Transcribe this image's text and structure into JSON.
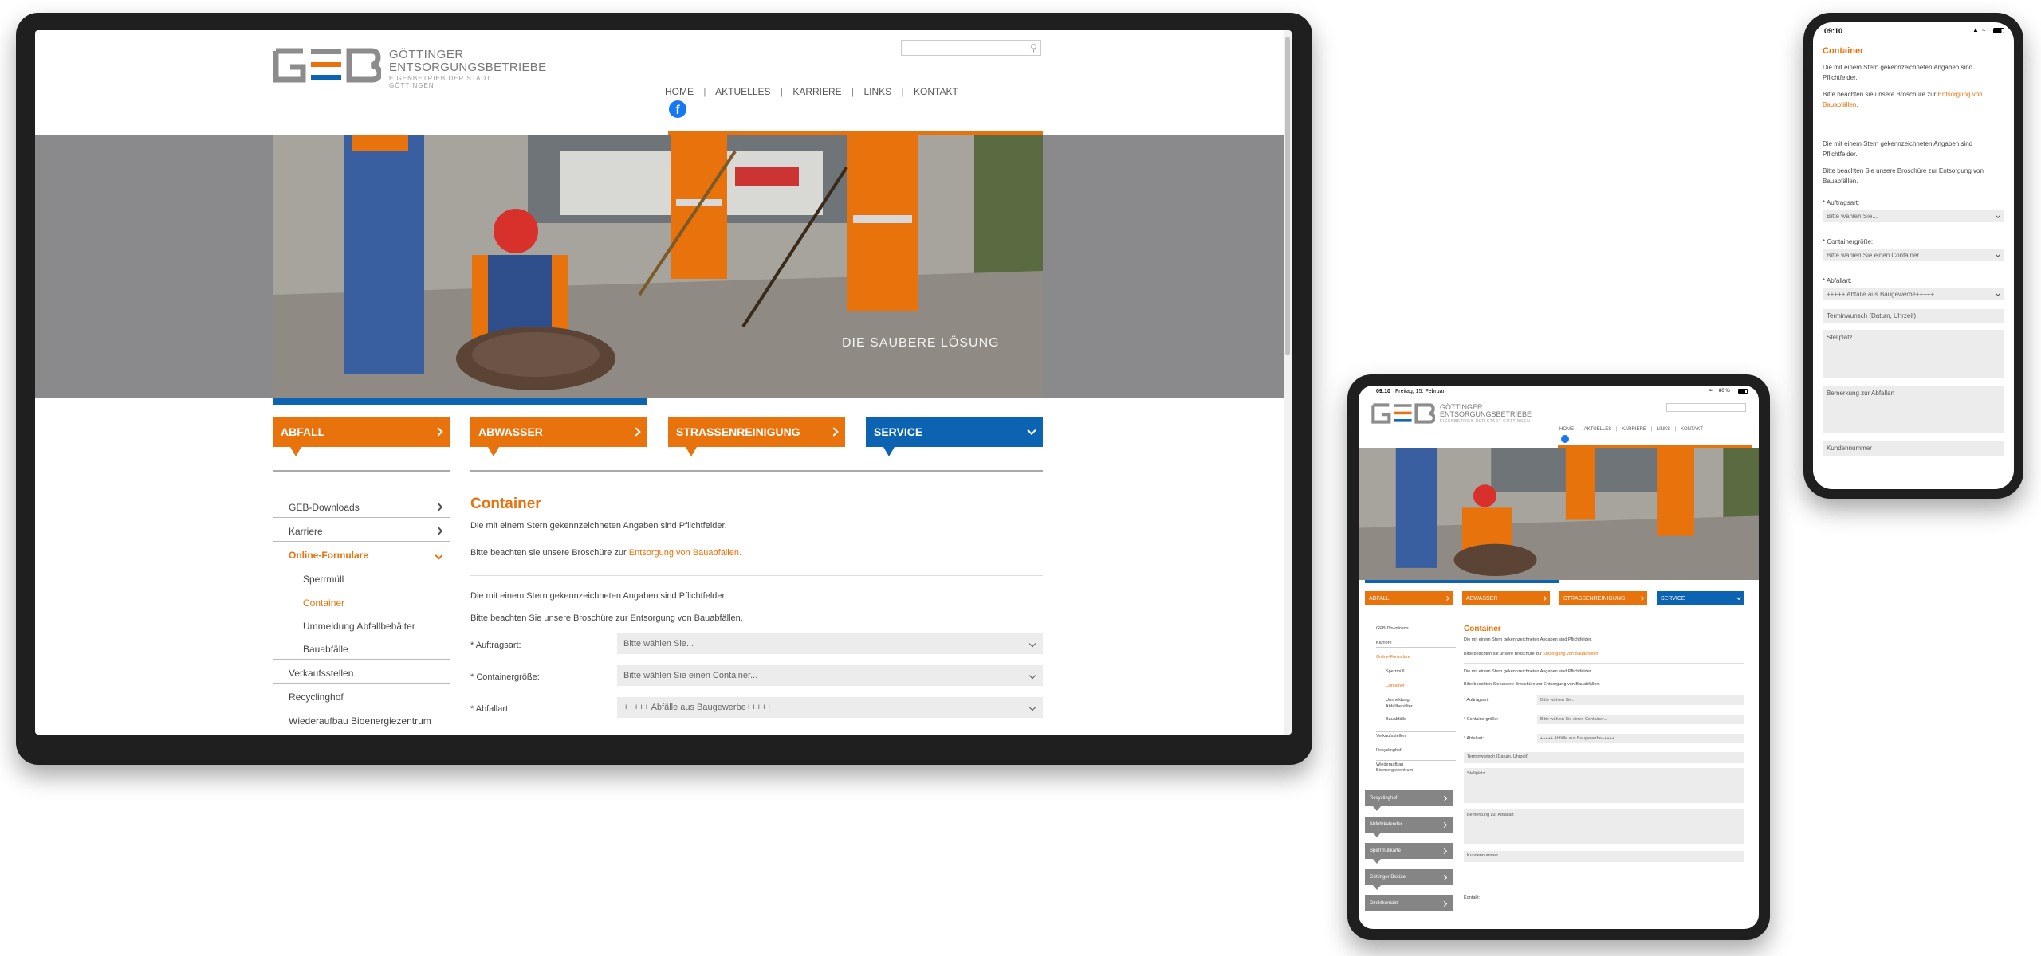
{
  "brand": {
    "logo_text": "GEB",
    "name_line1": "GÖTTINGER",
    "name_line2": "ENTSORGUNGSBETRIEBE",
    "tagline": "EIGENBETRIEB DER STADT GÖTTINGEN"
  },
  "colors": {
    "orange": "#e8720c",
    "blue": "#0b63b1",
    "grey": "#858585"
  },
  "icons": {
    "search": "search-icon",
    "facebook": "facebook-icon",
    "chevron": "chevron-right-icon"
  },
  "nav": {
    "items": [
      "HOME",
      "AKTUELLES",
      "KARRIERE",
      "LINKS",
      "KONTAKT"
    ],
    "separator": "|"
  },
  "hero": {
    "caption": "DIE SAUBERE LÖSUNG"
  },
  "tabs": [
    {
      "label": "ABFALL"
    },
    {
      "label": "ABWASSER"
    },
    {
      "label": "STRASSENREINIGUNG"
    },
    {
      "label": "SERVICE"
    }
  ],
  "sidebar": {
    "items": [
      {
        "label": "GEB-Downloads"
      },
      {
        "label": "Karriere"
      },
      {
        "label": "Online-Formulare"
      },
      {
        "label": "Sperrmüll"
      },
      {
        "label": "Container"
      },
      {
        "label": "Ummeldung Abfallbehälter"
      },
      {
        "label": "Bauabfälle"
      },
      {
        "label": "Verkaufsstellen"
      },
      {
        "label": "Recyclinghof"
      },
      {
        "label": "Wiederaufbau Bioenergiezentrum"
      }
    ],
    "tablet_sub": {
      "ummeldung_line1": "Ummeldung",
      "ummeldung_line2": "Abfallbehälter",
      "wieder_line1": "Wiederaufbau",
      "wieder_line2": "Bioenergiezentrum"
    },
    "promo_buttons": [
      "Recyclinghof",
      "Abfuhrkalender",
      "Sperrmüllkarte",
      "Göttinger Biotüte",
      "Direktkontakt"
    ]
  },
  "content": {
    "title": "Container",
    "intro1": "Die mit einem Stern gekennzeichneten Angaben sind Pflichtfelder.",
    "intro2_prefix": "Bitte beachten sie unsere Broschüre zur",
    "intro2_link": "Entsorgung von Bauabfällen.",
    "intro3": "Die mit einem Stern gekennzeichneten Angaben sind Pflichtfelder.",
    "intro4": "Bitte beachten Sie unsere Broschüre zur Entsorgung von Bauabfällen.",
    "mobile_intro2_link": "Entsorgung von Bauabfällen.",
    "form": {
      "auftragsart_label": "* Auftragsart:",
      "auftragsart_value": "Bitte wählen Sie...",
      "groesse_label": "* Containergröße:",
      "groesse_value": "Bitte wählen Sie einen Container...",
      "abfallart_label": "* Abfallart:",
      "abfallart_value": "+++++ Abfälle aus Baugewerbe+++++",
      "termin_placeholder": "Terminwunsch (Datum, Uhrzeit)",
      "stellplatz_placeholder": "Stellplatz",
      "bemerkung_placeholder": "Bemerkung zur Abfallart",
      "kunden_placeholder": "Kundennummer",
      "kontakt_label": "Kontakt:"
    }
  },
  "tablet_status": {
    "time": "09:10",
    "date": "Freitag, 15. Februar",
    "battery": "80 %"
  },
  "phone_status": {
    "time": "09:10"
  }
}
